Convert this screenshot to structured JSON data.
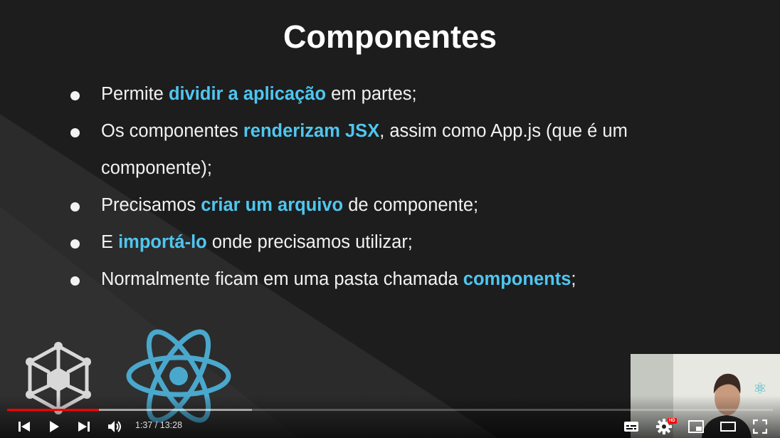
{
  "slide": {
    "title": "Componentes",
    "bullets": [
      [
        {
          "t": "Permite ",
          "hl": false
        },
        {
          "t": "dividir a aplicação",
          "hl": true
        },
        {
          "t": " em partes;",
          "hl": false
        }
      ],
      [
        {
          "t": "Os componentes ",
          "hl": false
        },
        {
          "t": "renderizam JSX",
          "hl": true
        },
        {
          "t": ", assim como App.js (que é um componente);",
          "hl": false
        }
      ],
      [
        {
          "t": "Precisamos ",
          "hl": false
        },
        {
          "t": "criar um arquivo",
          "hl": true
        },
        {
          "t": " de componente;",
          "hl": false
        }
      ],
      [
        {
          "t": "E ",
          "hl": false
        },
        {
          "t": "importá-lo",
          "hl": true
        },
        {
          "t": " onde precisamos utilizar;",
          "hl": false
        }
      ],
      [
        {
          "t": "Normalmente ficam em uma pasta chamada ",
          "hl": false
        },
        {
          "t": "components",
          "hl": true
        },
        {
          "t": ";",
          "hl": false
        }
      ]
    ],
    "colors": {
      "highlight": "#4fc6f0",
      "text": "#f2f2f2",
      "background": "#1f1f1f",
      "react": "#4aa8cc"
    }
  },
  "player": {
    "current_time": "1:37",
    "duration": "13:28",
    "time_display": "1:37 / 13:28",
    "played_fraction": 0.12,
    "buffered_fraction": 0.32,
    "hd_badge": "HD",
    "icons": [
      "previous-icon",
      "play-icon",
      "next-icon",
      "volume-icon",
      "subtitles-icon",
      "settings-icon",
      "miniplayer-icon",
      "theater-icon",
      "fullscreen-icon"
    ],
    "colors": {
      "progress_played": "#ff0000"
    }
  }
}
